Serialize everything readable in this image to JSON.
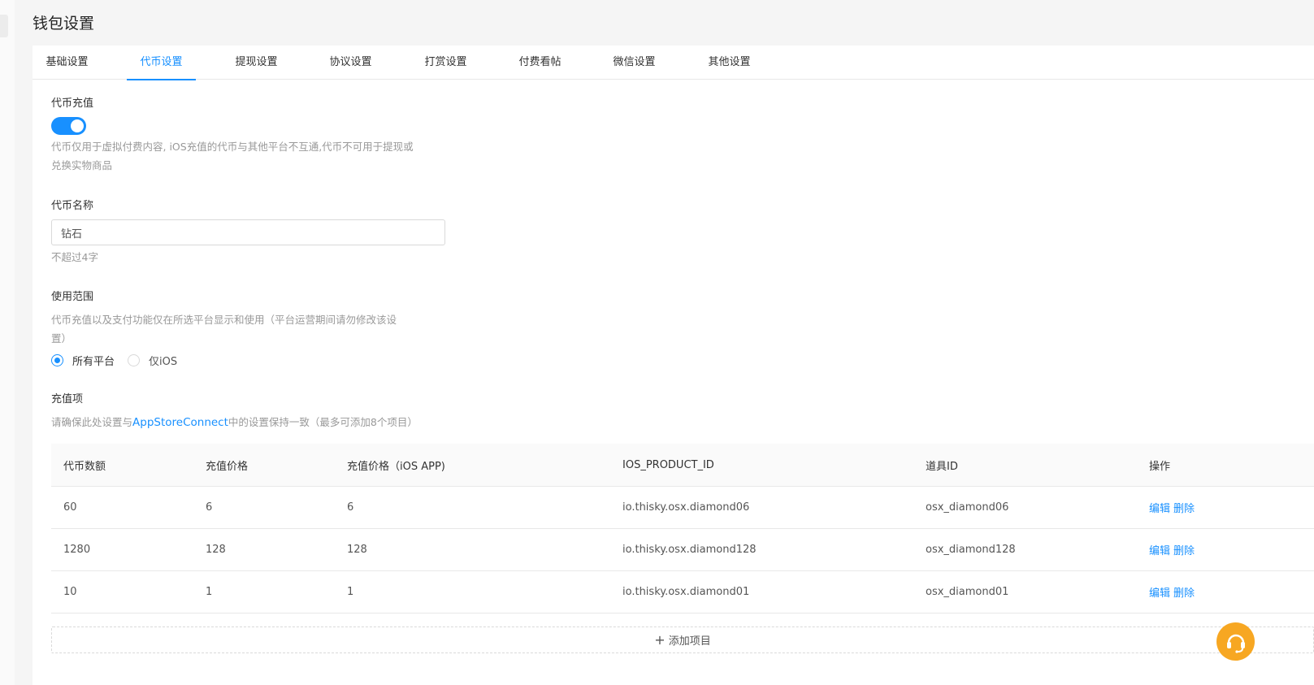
{
  "page": {
    "title": "钱包设置"
  },
  "tabs": [
    {
      "label": "基础设置"
    },
    {
      "label": "代币设置"
    },
    {
      "label": "提现设置"
    },
    {
      "label": "协议设置"
    },
    {
      "label": "打赏设置"
    },
    {
      "label": "付费看帖"
    },
    {
      "label": "微信设置"
    },
    {
      "label": "其他设置"
    }
  ],
  "token_recharge": {
    "label": "代币充值",
    "enabled": true,
    "hint_line1": "代币仅用于虚拟付费内容, iOS充值的代币与其他平台不互通,代币不可用于提现或",
    "hint_line2": "兑换实物商品"
  },
  "token_name": {
    "label": "代币名称",
    "value": "钻石",
    "hint": "不超过4字"
  },
  "usage_scope": {
    "label": "使用范围",
    "hint_line1": "代币充值以及支付功能仅在所选平台显示和使用（平台运营期间请勿修改该设",
    "hint_line2": "置）",
    "options": [
      {
        "label": "所有平台",
        "checked": true
      },
      {
        "label": "仅iOS",
        "checked": false
      }
    ]
  },
  "recharge_items": {
    "label": "充值项",
    "hint_before": "请确保此处设置与",
    "hint_link": "AppStoreConnect",
    "hint_after": "中的设置保持一致（最多可添加8个项目）",
    "columns": [
      "代币数额",
      "充值价格",
      "充值价格（iOS APP)",
      "IOS_PRODUCT_ID",
      "道具ID",
      "操作"
    ],
    "rows": [
      {
        "amount": "60",
        "price": "6",
        "ios_price": "6",
        "product_id": "io.thisky.osx.diamond06",
        "item_id": "osx_diamond06"
      },
      {
        "amount": "1280",
        "price": "128",
        "ios_price": "128",
        "product_id": "io.thisky.osx.diamond128",
        "item_id": "osx_diamond128"
      },
      {
        "amount": "10",
        "price": "1",
        "ios_price": "1",
        "product_id": "io.thisky.osx.diamond01",
        "item_id": "osx_diamond01"
      }
    ],
    "edit_label": "编辑",
    "delete_label": "删除",
    "add_label": "添加项目"
  },
  "colors": {
    "accent": "#1890ff",
    "support": "#f7a722"
  },
  "icons": {
    "support": "customer-service-headset-icon",
    "add": "plus-icon"
  }
}
